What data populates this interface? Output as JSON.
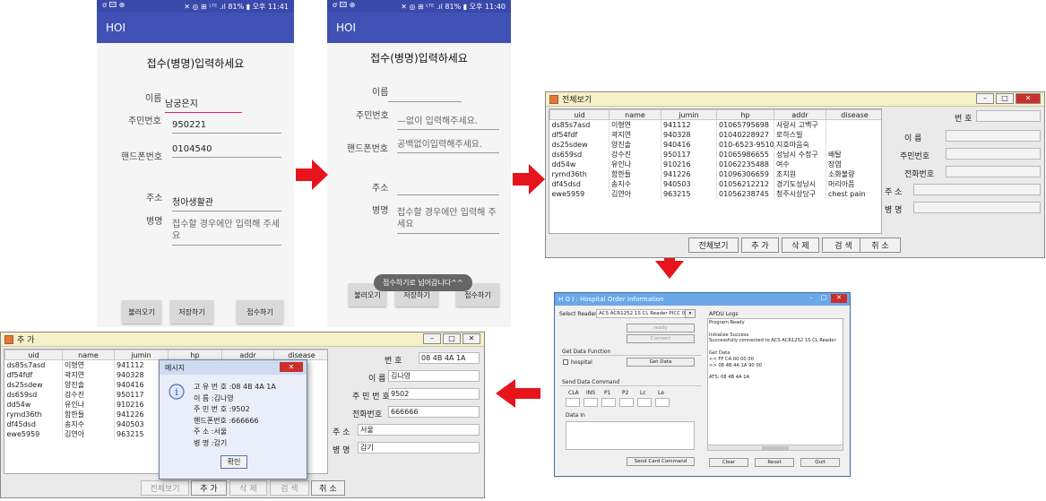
{
  "phone1": {
    "status_left": "ơ 🖾 ⊕",
    "status_right": "✕ ◎ ⊞ ᴸᵀᴱ .ıl 81% ▮ 오후 11:41",
    "app_title": "HOI",
    "heading": "접수(병명)입력하세요",
    "name_label": "이름",
    "name_value": "남궁은지",
    "rrn_label": "주민번호",
    "rrn_value": "950221",
    "phone_label": "핸드폰번호",
    "phone_value": "0104540",
    "addr_label": "주소",
    "addr_value": "청아생활관",
    "disease_label": "병명",
    "disease_hint": "접수할 경우에만 입력해 주세요",
    "btn_load": "불러오기",
    "btn_save": "저장하기",
    "btn_submit": "접수하기"
  },
  "phone2": {
    "status_left": "ơ 🖾 ⊕",
    "status_right": "✕ ◎ ⊞ ᴸᵀᴱ .ıl 81% ▮ 오후 11:40",
    "app_title": "HOI",
    "heading": "접수(병명)입력하세요",
    "name_label": "이름",
    "rrn_label": "주민번호",
    "rrn_hint": "—없이 입력해주세요.",
    "phone_label": "핸드폰번호",
    "phone_hint": "공백없이입력해주세요.",
    "addr_label": "주소",
    "disease_label": "병명",
    "disease_hint": "접수할 경우에만 입력해 주세요",
    "btn_load": "불러오기",
    "btn_save": "저장하기",
    "btn_submit": "접수하기",
    "toast": "접수하기로 넘어갑니다^^"
  },
  "viewall": {
    "title": "전체보기",
    "columns": [
      "uid",
      "name",
      "jumin",
      "hp",
      "addr",
      "disease"
    ],
    "rows": [
      [
        "ds85s7asd",
        "이형연",
        "941112",
        "01065795698",
        "사랑시 고백구",
        ""
      ],
      [
        "df54fdf",
        "곽지연",
        "940328",
        "01040228927",
        "로하스빌",
        ""
      ],
      [
        "ds25sdew",
        "양진솔",
        "940416",
        "010-6523-9510",
        "지호마음숙",
        ""
      ],
      [
        "ds659sd",
        "강수진",
        "950117",
        "01065986655",
        "성남시 수정구",
        "배탈"
      ],
      [
        "dd54w",
        "유인나",
        "910216",
        "01062235488",
        "여수",
        "장염"
      ],
      [
        "rymd36th",
        "함한들",
        "941226",
        "01096306659",
        "조치원",
        "소화불량"
      ],
      [
        "df45dsd",
        "송지수",
        "940503",
        "01056212212",
        "경기도성남시",
        "머리아픔"
      ],
      [
        "ewe5959",
        "김연아",
        "963215",
        "01056238745",
        "청주시상당구",
        "chest pain"
      ]
    ],
    "labels": [
      "번 호",
      "이 름",
      "주민번호",
      "전화번호",
      "주   소",
      "병   명"
    ],
    "btn_all": "전체보기",
    "btn_add": "추 가",
    "btn_delete": "삭 제",
    "btn_search": "검 색",
    "btn_cancel": "취 소"
  },
  "hospital": {
    "title": "H O I : Hospital Order Information",
    "select_reader_label": "Select Reader",
    "reader_value": "ACS ACR1252 1S CL Reader PICC 0",
    "btn_ready": "ready",
    "btn_connect": "Connect",
    "get_data_label": "Get Data Function",
    "hospital_checkbox": "hospital",
    "btn_get_data": "Get Data",
    "send_cmd_label": "Send Data Command",
    "apdu_fields": [
      "CLA",
      "INS",
      "P1",
      "P2",
      "Lc",
      "Le"
    ],
    "data_in_label": "Data In",
    "btn_send": "Send Card Command",
    "apdu_logs_label": "APDU Logs",
    "log_lines": [
      "Program Ready",
      "",
      "Initialize Success",
      "Successfully connected to ACS ACR1252 1S CL Reader",
      "",
      "Get Data",
      "<< FF CA 00 00 00",
      ">> 08 4B 4A 1A 90 00",
      "",
      "ATS: 08 4B 4A 1A"
    ],
    "btn_clear": "Clear",
    "btn_reset": "Reset",
    "btn_quit": "Quit"
  },
  "addwin": {
    "title": "추   가",
    "columns": [
      "uid",
      "name",
      "jumin",
      "hp",
      "addr",
      "disease"
    ],
    "rows": [
      [
        "ds85s7asd",
        "이형연",
        "941112"
      ],
      [
        "df54fdf",
        "곽지연",
        "940328"
      ],
      [
        "ds25sdew",
        "양진솔",
        "940416"
      ],
      [
        "ds659sd",
        "강수진",
        "950117"
      ],
      [
        "dd54w",
        "유인나",
        "910216"
      ],
      [
        "rymd36th",
        "함한들",
        "941226"
      ],
      [
        "df45dsd",
        "송지수",
        "940503"
      ],
      [
        "ewe5959",
        "김연아",
        "963215"
      ]
    ],
    "labels": [
      "번 호",
      "이 름",
      "주 민 번 호",
      "전화번호",
      "주   소",
      "병   명"
    ],
    "values": [
      "08 4B 4A 1A",
      "김나영",
      "9502",
      "666666",
      "서울",
      "감기"
    ],
    "btn_all": "전체보기",
    "btn_add": "추 가",
    "btn_delete": "삭 제",
    "btn_search": "검 색",
    "btn_cancel": "취 소",
    "dialog": {
      "title": "메시지",
      "lines": [
        "고 유 번 호 :08 4B 4A 1A",
        "이       름 :김나영",
        "주 민 번 호 :9502",
        "핸드폰번호 :666666",
        "주       소 :서울",
        "병       명 :감기"
      ],
      "ok": "확인"
    }
  },
  "colors": {
    "arrow": "#e8141c",
    "appbar": "#3f51b5",
    "focus_line": "#e91e63"
  }
}
